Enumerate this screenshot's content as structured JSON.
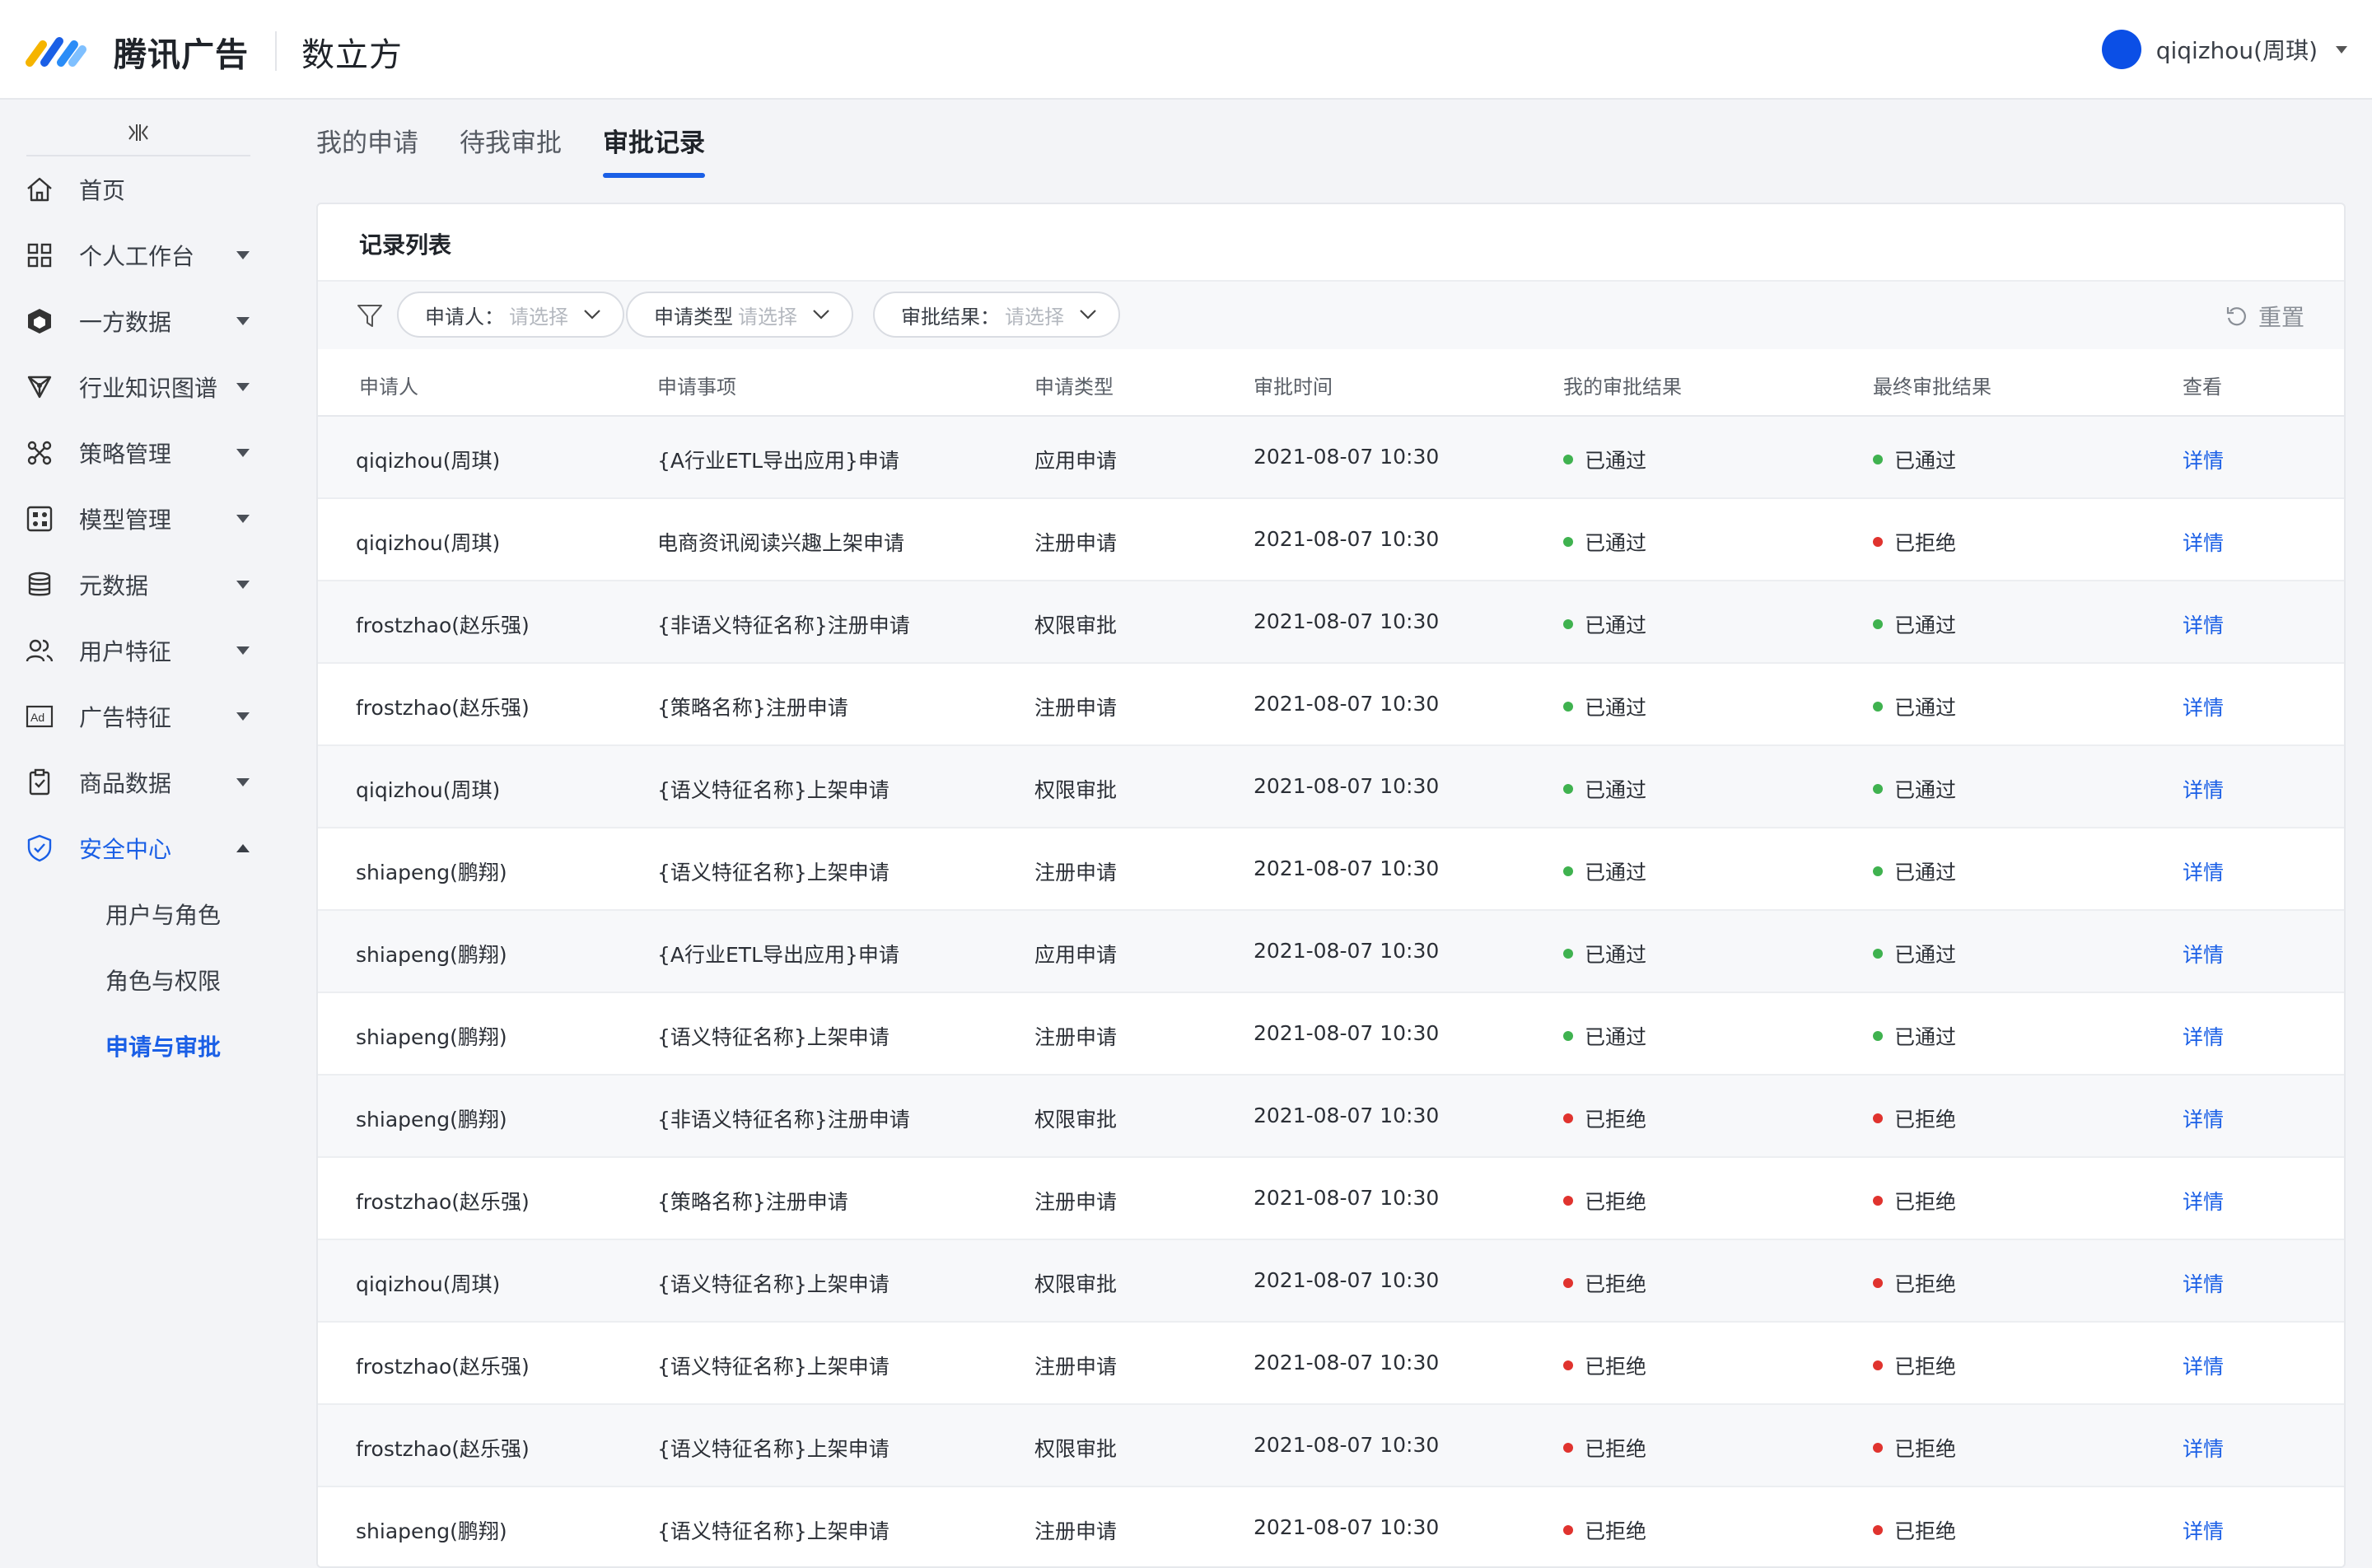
{
  "header": {
    "brand": "腾讯广告",
    "product": "数立方",
    "user": "qiqizhou(周琪)"
  },
  "sidebar": {
    "items": [
      {
        "label": "首页",
        "icon": "home-icon",
        "caret": ""
      },
      {
        "label": "个人工作台",
        "icon": "grid-icon",
        "caret": "down"
      },
      {
        "label": "一方数据",
        "icon": "cube-icon",
        "caret": "down"
      },
      {
        "label": "行业知识图谱",
        "icon": "graph-icon",
        "caret": "down"
      },
      {
        "label": "策略管理",
        "icon": "strategy-icon",
        "caret": "down"
      },
      {
        "label": "模型管理",
        "icon": "model-icon",
        "caret": "down"
      },
      {
        "label": "元数据",
        "icon": "database-icon",
        "caret": "down"
      },
      {
        "label": "用户特征",
        "icon": "users-icon",
        "caret": "down"
      },
      {
        "label": "广告特征",
        "icon": "ad-icon",
        "caret": "down"
      },
      {
        "label": "商品数据",
        "icon": "clipboard-icon",
        "caret": "down"
      },
      {
        "label": "安全中心",
        "icon": "shield-icon",
        "caret": "up",
        "active": true
      }
    ],
    "sub_items": [
      {
        "label": "用户与角色"
      },
      {
        "label": "角色与权限"
      },
      {
        "label": "申请与审批",
        "active": true
      }
    ]
  },
  "tabs": [
    {
      "label": "我的申请"
    },
    {
      "label": "待我审批"
    },
    {
      "label": "审批记录",
      "active": true
    }
  ],
  "card": {
    "title": "记录列表",
    "filters": [
      {
        "key": "申请人：",
        "placeholder": "请选择"
      },
      {
        "key": "申请类型",
        "placeholder": "请选择"
      },
      {
        "key": "审批结果：",
        "placeholder": "请选择"
      }
    ],
    "reset_label": "重置"
  },
  "table": {
    "columns": [
      "申请人",
      "申请事项",
      "申请类型",
      "审批时间",
      "我的审批结果",
      "最终审批结果",
      "查看"
    ],
    "rows": [
      [
        "qiqizhou(周琪)",
        "{A行业ETL导出应用}申请",
        "应用申请",
        "2021-08-07 10:30",
        "已通过",
        "已通过",
        "详情"
      ],
      [
        "qiqizhou(周琪)",
        "电商资讯阅读兴趣上架申请",
        "注册申请",
        "2021-08-07 10:30",
        "已通过",
        "已拒绝",
        "详情"
      ],
      [
        "frostzhao(赵乐强)",
        "{非语义特征名称}注册申请",
        "权限审批",
        "2021-08-07 10:30",
        "已通过",
        "已通过",
        "详情"
      ],
      [
        "frostzhao(赵乐强)",
        "{策略名称}注册申请",
        "注册申请",
        "2021-08-07 10:30",
        "已通过",
        "已通过",
        "详情"
      ],
      [
        "qiqizhou(周琪)",
        "{语义特征名称}上架申请",
        "权限审批",
        "2021-08-07 10:30",
        "已通过",
        "已通过",
        "详情"
      ],
      [
        "shiapeng(鹏翔)",
        "{语义特征名称}上架申请",
        "注册申请",
        "2021-08-07 10:30",
        "已通过",
        "已通过",
        "详情"
      ],
      [
        "shiapeng(鹏翔)",
        "{A行业ETL导出应用}申请",
        "应用申请",
        "2021-08-07 10:30",
        "已通过",
        "已通过",
        "详情"
      ],
      [
        "shiapeng(鹏翔)",
        "{语义特征名称}上架申请",
        "注册申请",
        "2021-08-07 10:30",
        "已通过",
        "已通过",
        "详情"
      ],
      [
        "shiapeng(鹏翔)",
        "{非语义特征名称}注册申请",
        "权限审批",
        "2021-08-07 10:30",
        "已拒绝",
        "已拒绝",
        "详情"
      ],
      [
        "frostzhao(赵乐强)",
        "{策略名称}注册申请",
        "注册申请",
        "2021-08-07 10:30",
        "已拒绝",
        "已拒绝",
        "详情"
      ],
      [
        "qiqizhou(周琪)",
        "{语义特征名称}上架申请",
        "权限审批",
        "2021-08-07 10:30",
        "已拒绝",
        "已拒绝",
        "详情"
      ],
      [
        "frostzhao(赵乐强)",
        "{语义特征名称}上架申请",
        "注册申请",
        "2021-08-07 10:30",
        "已拒绝",
        "已拒绝",
        "详情"
      ],
      [
        "frostzhao(赵乐强)",
        "{语义特征名称}上架申请",
        "权限审批",
        "2021-08-07 10:30",
        "已拒绝",
        "已拒绝",
        "详情"
      ],
      [
        "shiapeng(鹏翔)",
        "{语义特征名称}上架申请",
        "注册申请",
        "2021-08-07 10:30",
        "已拒绝",
        "已拒绝",
        "详情"
      ]
    ]
  },
  "colors": {
    "accent": "#1a5fe6",
    "approved": "#3fb24f",
    "rejected": "#e0332e"
  }
}
